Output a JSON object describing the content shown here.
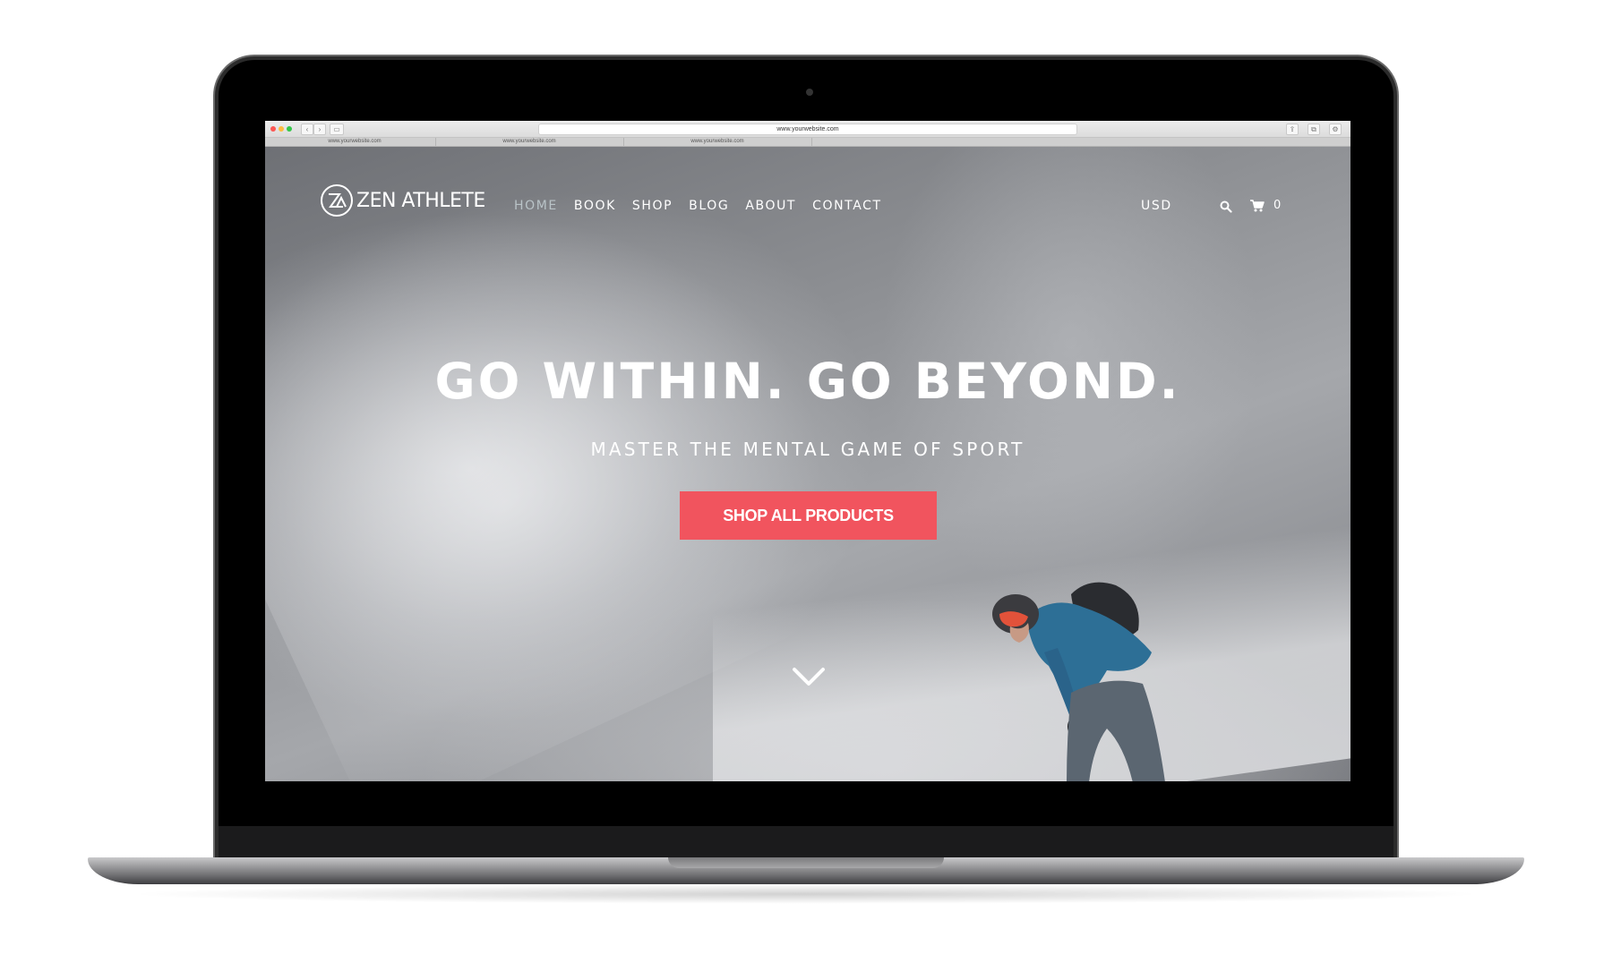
{
  "browser": {
    "url": "www.yourwebsite.com",
    "tabs": [
      {
        "label": "www.yourwebsite.com"
      },
      {
        "label": "www.yourwebsite.com"
      },
      {
        "label": "www.yourwebsite.com"
      }
    ]
  },
  "site": {
    "logo_text": "ZEN ATHLETE",
    "nav": [
      {
        "label": "HOME",
        "active": true
      },
      {
        "label": "BOOK",
        "active": false
      },
      {
        "label": "SHOP",
        "active": false
      },
      {
        "label": "BLOG",
        "active": false
      },
      {
        "label": "ABOUT",
        "active": false
      },
      {
        "label": "CONTACT",
        "active": false
      }
    ],
    "currency": "USD",
    "cart_count": "0",
    "icons": {
      "search": "search-icon",
      "cart": "cart-icon",
      "scroll": "chevron-down-icon"
    }
  },
  "hero": {
    "headline": "GO WITHIN. GO BEYOND.",
    "subline": "MASTER THE MENTAL GAME OF SPORT",
    "cta_label": "SHOP ALL PRODUCTS"
  },
  "colors": {
    "accent": "#f1545e",
    "nav_active": "#b9c3c7",
    "text": "#ffffff"
  }
}
